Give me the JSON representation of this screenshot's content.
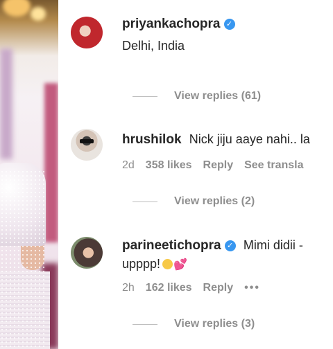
{
  "comments": [
    {
      "username": "priyankachopra",
      "verified": true,
      "text": "Delhi, India",
      "view_replies": "View replies (61)"
    },
    {
      "username": "hrushilok",
      "verified": false,
      "text": "Nick jiju aaye nahi.. la",
      "time": "2d",
      "likes": "358 likes",
      "reply": "Reply",
      "see_translation": "See transla",
      "view_replies": "View replies (2)"
    },
    {
      "username": "parineetichopra",
      "verified": true,
      "text": "Mimi didii -",
      "text_line2": "upppp!",
      "time": "2h",
      "likes": "162 likes",
      "reply": "Reply",
      "more": "•••",
      "view_replies": "View replies (3)"
    }
  ],
  "icons": {
    "verified": "check-badge-icon",
    "emoji": [
      "grinning-face-emoji",
      "two-hearts-emoji"
    ]
  },
  "colors": {
    "verified": "#3897f0",
    "secondary_text": "#8e8e8e",
    "primary_text": "#262626"
  }
}
